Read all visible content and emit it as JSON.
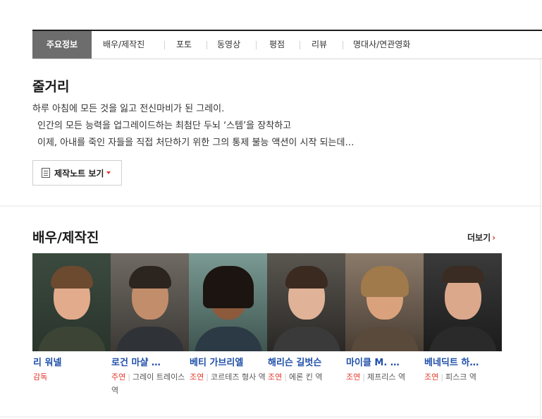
{
  "tabs": [
    {
      "label": "주요정보",
      "active": true
    },
    {
      "label": "배우/제작진"
    },
    {
      "label": "포토"
    },
    {
      "label": "동영상"
    },
    {
      "label": "평점"
    },
    {
      "label": "리뷰"
    },
    {
      "label": "명대사/연관영화"
    }
  ],
  "synopsis": {
    "title": "줄거리",
    "lines": [
      "하루 아침에 모든 것을 잃고 전신마비가 된 그레이.",
      "인간의 모든 능력을 업그레이드하는 최첨단 두뇌 ‘스템’을 장착하고",
      "이제, 아내를 죽인 자들을 직접 처단하기 위한 그의 통제 불능 액션이 시작 되는데…"
    ],
    "note_button": "제작노트 보기"
  },
  "cast_section": {
    "title": "배우/제작진",
    "more": "더보기",
    "people": [
      {
        "name": "리 워넬",
        "role_type": "감독",
        "role": ""
      },
      {
        "name": "로건 마샬 …",
        "role_type": "주연",
        "role": "그레이 트레이스 역"
      },
      {
        "name": "베티 가브리엘",
        "role_type": "조연",
        "role": "코르테즈 형사 역"
      },
      {
        "name": "해리슨 길벗슨",
        "role_type": "조연",
        "role": "에론 킨 역"
      },
      {
        "name": "마이클 M. …",
        "role_type": "조연",
        "role": "제프리스 역"
      },
      {
        "name": "베네딕트 하…",
        "role_type": "조연",
        "role": "피스크 역"
      }
    ]
  },
  "colors": {
    "accent": "#e3382b",
    "name_link": "#1f4faa",
    "active_tab": "#6d6d6d"
  }
}
